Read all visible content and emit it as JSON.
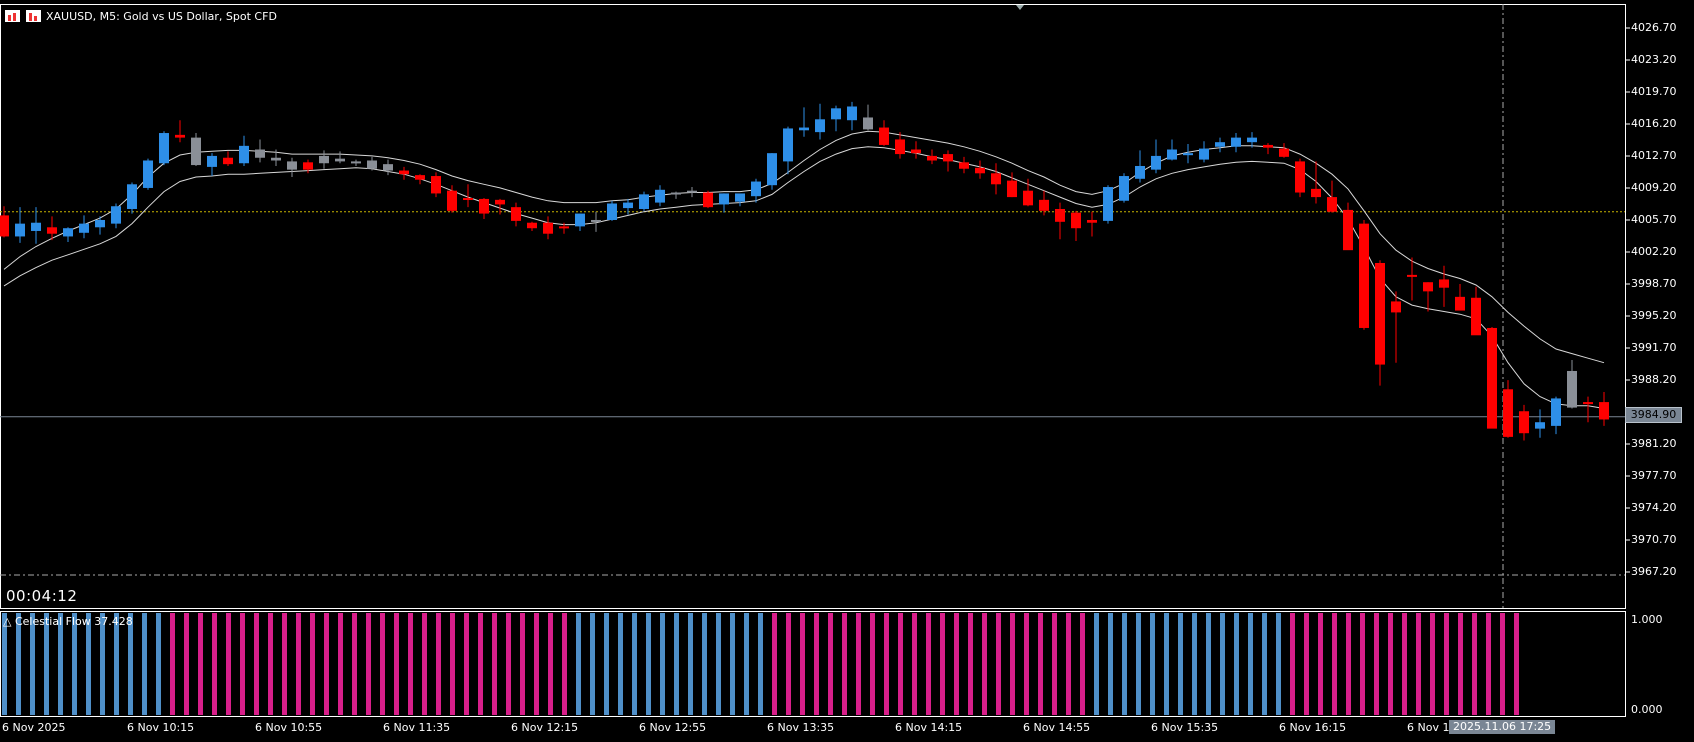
{
  "window": {
    "title": "XAUUSD, M5:  Gold vs US Dollar, Spot CFD",
    "countdown": "00:04:12"
  },
  "price_axis": {
    "labels": [
      "4026.70",
      "4023.20",
      "4019.70",
      "4016.20",
      "4012.70",
      "4009.20",
      "4005.70",
      "4002.20",
      "3998.70",
      "3995.20",
      "3991.70",
      "3988.20",
      "3984.90",
      "3981.20",
      "3977.70",
      "3974.20",
      "3970.70",
      "3967.20"
    ],
    "current_price": "3984.90"
  },
  "time_axis": {
    "labels": [
      "6 Nov 2025",
      "6 Nov 10:15",
      "6 Nov 10:55",
      "6 Nov 11:35",
      "6 Nov 12:15",
      "6 Nov 12:55",
      "6 Nov 13:35",
      "6 Nov 14:15",
      "6 Nov 14:55",
      "6 Nov 15:35",
      "6 Nov 16:15",
      "6 Nov 1"
    ],
    "crosshair_time": "2025.11.06 17:25"
  },
  "indicator": {
    "name": "Celestial Flow 37.428",
    "axis_labels": [
      "1.000",
      "0.000"
    ],
    "pattern": "BBBBBBBBBBBBPPPPPPPPPPPPPPPPPPPPPPPPPPPPPBBBBBBBBBBBBBBPPPPPPPPPPPPPPPPPPPPPPPBBBBBBBBBBBBBBPPPPPPPPPPPPPPPPPPPPP"
  },
  "colors": {
    "bull": "#2e8fe8",
    "bear": "#ff0000",
    "neutral": "#8a8f97",
    "ma": "#d8d8d8",
    "level_line": "#c8b400",
    "hist_blue": "#4f8fc8",
    "hist_pink": "#d81f8b"
  },
  "chart_data": {
    "type": "candlestick",
    "symbol": "XAUUSD",
    "timeframe": "M5",
    "candles": [
      [
        4006.9,
        4007.9,
        4004.5,
        4004.6,
        "bear"
      ],
      [
        4004.6,
        4007.8,
        4003.9,
        4006.0,
        "bull"
      ],
      [
        4005.2,
        4007.8,
        4003.8,
        4006.1,
        "bull"
      ],
      [
        4005.6,
        4006.8,
        4004.2,
        4004.9,
        "bear"
      ],
      [
        4004.6,
        4005.6,
        4004.0,
        4005.5,
        "bull"
      ],
      [
        4005.0,
        4006.9,
        4004.4,
        4006.0,
        "bull"
      ],
      [
        4005.6,
        4006.8,
        4004.8,
        4006.4,
        "bull"
      ],
      [
        4006.0,
        4008.2,
        4005.5,
        4007.9,
        "bull"
      ],
      [
        4007.6,
        4010.5,
        4007.1,
        4010.3,
        "bull"
      ],
      [
        4009.9,
        4013.1,
        4009.7,
        4012.9,
        "bull"
      ],
      [
        4012.6,
        4016.1,
        4012.4,
        4015.9,
        "bull"
      ],
      [
        4015.7,
        4017.3,
        4014.9,
        4015.4,
        "bear"
      ],
      [
        4015.4,
        4015.9,
        4012.3,
        4012.4,
        "neutral"
      ],
      [
        4012.2,
        4013.7,
        4011.2,
        4013.4,
        "bull"
      ],
      [
        4013.2,
        4013.9,
        4012.3,
        4012.5,
        "bear"
      ],
      [
        4012.6,
        4015.6,
        4012.3,
        4014.5,
        "bull"
      ],
      [
        4014.1,
        4015.2,
        4012.7,
        4013.2,
        "neutral"
      ],
      [
        4013.2,
        4014.1,
        4012.3,
        4012.9,
        "neutral"
      ],
      [
        4012.8,
        4013.2,
        4011.1,
        4011.9,
        "neutral"
      ],
      [
        4011.9,
        4013.0,
        4011.5,
        4012.7,
        "bear"
      ],
      [
        4012.6,
        4014.0,
        4012.0,
        4013.4,
        "neutral"
      ],
      [
        4013.1,
        4013.9,
        4012.6,
        4012.8,
        "neutral"
      ],
      [
        4012.8,
        4013.0,
        4012.3,
        4012.6,
        "neutral"
      ],
      [
        4012.9,
        4013.3,
        4011.8,
        4012.0,
        "neutral"
      ],
      [
        4012.5,
        4013.0,
        4011.3,
        4011.8,
        "neutral"
      ],
      [
        4011.8,
        4012.2,
        4010.8,
        4011.4,
        "bear"
      ],
      [
        4011.3,
        4011.4,
        4010.3,
        4010.8,
        "bear"
      ],
      [
        4011.2,
        4011.6,
        4008.9,
        4009.3,
        "bear"
      ],
      [
        4009.6,
        4010.2,
        4007.2,
        4007.4,
        "bear"
      ],
      [
        4008.8,
        4010.3,
        4007.8,
        4008.6,
        "bear"
      ],
      [
        4008.7,
        4008.8,
        4006.5,
        4007.1,
        "bear"
      ],
      [
        4008.6,
        4008.7,
        4007.0,
        4008.1,
        "bear"
      ],
      [
        4007.8,
        4008.3,
        4005.7,
        4006.3,
        "bear"
      ],
      [
        4006.1,
        4006.2,
        4005.2,
        4005.5,
        "bear"
      ],
      [
        4006.1,
        4006.8,
        4004.3,
        4004.9,
        "bear"
      ],
      [
        4005.5,
        4006.1,
        4004.9,
        4005.7,
        "bear"
      ],
      [
        4005.7,
        4007.1,
        4005.2,
        4007.1,
        "bull"
      ],
      [
        4006.4,
        4007.3,
        4005.1,
        4006.2,
        "neutral"
      ],
      [
        4006.4,
        4008.5,
        4006.3,
        4008.2,
        "bull"
      ],
      [
        4007.7,
        4008.7,
        4007.0,
        4008.3,
        "bull"
      ],
      [
        4007.6,
        4009.5,
        4007.4,
        4009.2,
        "bull"
      ],
      [
        4008.3,
        4010.2,
        4007.9,
        4009.7,
        "bull"
      ],
      [
        4009.4,
        4009.5,
        4008.7,
        4009.2,
        "neutral"
      ],
      [
        4009.5,
        4010.0,
        4008.9,
        4009.6,
        "neutral"
      ],
      [
        4009.4,
        4009.6,
        4007.7,
        4007.8,
        "bear"
      ],
      [
        4008.1,
        4009.3,
        4007.2,
        4009.3,
        "bull"
      ],
      [
        4008.4,
        4009.2,
        4007.9,
        4009.3,
        "bull"
      ],
      [
        4009.0,
        4010.9,
        4008.3,
        4010.6,
        "bull"
      ],
      [
        4010.2,
        4013.7,
        4009.7,
        4013.7,
        "bull"
      ],
      [
        4012.8,
        4016.6,
        4011.4,
        4016.4,
        "bull"
      ],
      [
        4016.2,
        4018.7,
        4015.5,
        4016.5,
        "bull"
      ],
      [
        4016.0,
        4019.1,
        4015.2,
        4017.4,
        "bull"
      ],
      [
        4017.4,
        4018.9,
        4016.1,
        4018.6,
        "bull"
      ],
      [
        4018.8,
        4019.3,
        4016.2,
        4017.3,
        "bull"
      ],
      [
        4017.6,
        4019.0,
        4016.2,
        4016.3,
        "neutral"
      ],
      [
        4016.5,
        4017.3,
        4014.5,
        4014.6,
        "bear"
      ],
      [
        4015.2,
        4016.0,
        4013.1,
        4013.6,
        "bear"
      ],
      [
        4013.7,
        4015.0,
        4013.1,
        4014.1,
        "bear"
      ],
      [
        4013.4,
        4014.1,
        4012.5,
        4012.9,
        "bear"
      ],
      [
        4013.6,
        4014.0,
        4011.7,
        4012.8,
        "bear"
      ],
      [
        4012.7,
        4013.3,
        4011.5,
        4012.0,
        "bear"
      ],
      [
        4012.1,
        4012.9,
        4010.9,
        4011.5,
        "bear"
      ],
      [
        4011.5,
        4012.6,
        4009.2,
        4010.3,
        "bear"
      ],
      [
        4010.7,
        4011.6,
        4008.9,
        4008.9,
        "bear"
      ],
      [
        4009.6,
        4010.9,
        4007.9,
        4008.0,
        "bear"
      ],
      [
        4008.6,
        4009.6,
        4006.9,
        4007.4,
        "bear"
      ],
      [
        4007.6,
        4008.3,
        4004.3,
        4006.2,
        "bear"
      ],
      [
        4007.2,
        4007.4,
        4004.1,
        4005.5,
        "bear"
      ],
      [
        4006.1,
        4007.3,
        4004.6,
        4006.4,
        "bear"
      ],
      [
        4006.3,
        4010.2,
        4006.0,
        4010.0,
        "bull"
      ],
      [
        4008.5,
        4011.5,
        4008.3,
        4011.2,
        "bull"
      ],
      [
        4010.9,
        4014.0,
        4010.5,
        4012.3,
        "bull"
      ],
      [
        4011.9,
        4015.2,
        4011.5,
        4013.4,
        "bull"
      ],
      [
        4013.0,
        4015.2,
        4012.9,
        4014.1,
        "bull"
      ],
      [
        4013.7,
        4014.7,
        4012.6,
        4013.7,
        "bull"
      ],
      [
        4013.0,
        4015.0,
        4012.7,
        4014.2,
        "bull"
      ],
      [
        4014.4,
        4015.4,
        4013.8,
        4014.9,
        "bull"
      ],
      [
        4014.4,
        4015.9,
        4013.8,
        4015.4,
        "bull"
      ],
      [
        4015.4,
        4016.0,
        4014.3,
        4014.9,
        "bull"
      ],
      [
        4014.6,
        4014.8,
        4013.6,
        4014.3,
        "bear"
      ],
      [
        4014.2,
        4014.8,
        4013.2,
        4013.3,
        "bear"
      ],
      [
        4012.8,
        4013.1,
        4008.9,
        4009.4,
        "bear"
      ],
      [
        4009.8,
        4012.8,
        4008.2,
        4008.9,
        "bear"
      ],
      [
        4008.9,
        4010.7,
        4007.2,
        4007.3,
        "bear"
      ],
      [
        4007.5,
        4008.3,
        4003.2,
        4003.1,
        "bear"
      ],
      [
        4006.0,
        4006.4,
        3994.4,
        3994.6,
        "bear"
      ],
      [
        4001.7,
        4002.0,
        3988.3,
        3990.6,
        "bear"
      ],
      [
        3997.5,
        3998.6,
        3990.8,
        3996.3,
        "bear"
      ],
      [
        4000.3,
        4002.3,
        3997.6,
        4000.4,
        "bear"
      ],
      [
        3999.6,
        3999.6,
        3996.4,
        3998.6,
        "bear"
      ],
      [
        3999.9,
        4001.4,
        3996.9,
        3999.0,
        "bear"
      ],
      [
        3998.0,
        3999.4,
        3996.6,
        3996.5,
        "bear"
      ],
      [
        3997.9,
        3999.1,
        3996.0,
        3993.8,
        "bear"
      ],
      [
        3994.6,
        3994.7,
        3986.9,
        3983.6,
        "bear"
      ],
      [
        3987.9,
        3988.9,
        3982.6,
        3982.7,
        "bear"
      ],
      [
        3985.5,
        3986.2,
        3982.3,
        3983.1,
        "bear"
      ],
      [
        3983.6,
        3985.7,
        3982.6,
        3984.3,
        "bull"
      ],
      [
        3983.9,
        3987.1,
        3983.0,
        3986.9,
        "bull"
      ],
      [
        3989.9,
        3991.1,
        3985.8,
        3985.9,
        "neutral"
      ],
      [
        3986.4,
        3987.1,
        3984.3,
        3986.5,
        "bear"
      ],
      [
        3986.5,
        3987.6,
        3983.9,
        3984.6,
        "bear"
      ]
    ],
    "moving_averages": [
      {
        "name": "upper",
        "values": [
          4001.0,
          4002.4,
          4003.5,
          4004.4,
          4005.2,
          4005.9,
          4006.6,
          4007.6,
          4009.2,
          4011.1,
          4012.6,
          4013.5,
          4013.8,
          4013.9,
          4014.0,
          4014.0,
          4013.9,
          4013.8,
          4013.6,
          4013.6,
          4013.6,
          4013.6,
          4013.5,
          4013.4,
          4013.2,
          4012.9,
          4012.5,
          4011.9,
          4011.2,
          4010.7,
          4010.3,
          4009.9,
          4009.4,
          4008.9,
          4008.5,
          4008.3,
          4008.3,
          4008.3,
          4008.5,
          4008.6,
          4008.9,
          4009.1,
          4009.3,
          4009.4,
          4009.4,
          4009.5,
          4009.5,
          4009.7,
          4010.4,
          4011.6,
          4012.9,
          4014.1,
          4015.1,
          4015.8,
          4016.1,
          4016.0,
          4015.7,
          4015.4,
          4015.1,
          4014.8,
          4014.4,
          4013.9,
          4013.3,
          4012.6,
          4011.8,
          4011.1,
          4010.2,
          4009.5,
          4009.2,
          4009.6,
          4010.4,
          4011.6,
          4012.6,
          4013.4,
          4013.8,
          4014.1,
          4014.3,
          4014.5,
          4014.5,
          4014.4,
          4014.3,
          4013.6,
          4012.6,
          4011.4,
          4009.8,
          4007.4,
          4004.9,
          4003.1,
          4001.9,
          4001.1,
          4000.5,
          4000.0,
          3999.3,
          3998.0,
          3996.3,
          3994.8,
          3993.4,
          3992.3,
          3991.8,
          3991.3,
          3990.8
        ]
      },
      {
        "name": "lower",
        "values": [
          3999.2,
          4000.3,
          4001.2,
          4002.0,
          4002.6,
          4003.2,
          4003.8,
          4004.6,
          4006.0,
          4007.8,
          4009.5,
          4010.6,
          4011.1,
          4011.2,
          4011.4,
          4011.4,
          4011.5,
          4011.6,
          4011.7,
          4011.8,
          4011.9,
          4012.0,
          4012.1,
          4012.0,
          4011.7,
          4011.4,
          4010.9,
          4010.3,
          4009.6,
          4008.9,
          4008.3,
          4007.7,
          4007.1,
          4006.6,
          4006.1,
          4005.9,
          4005.9,
          4006.1,
          4006.5,
          4006.9,
          4007.3,
          4007.6,
          4007.8,
          4008.0,
          4008.1,
          4008.2,
          4008.3,
          4008.5,
          4009.2,
          4010.5,
          4011.7,
          4012.8,
          4013.6,
          4014.2,
          4014.4,
          4014.3,
          4014.0,
          4013.7,
          4013.3,
          4013.0,
          4012.6,
          4012.2,
          4011.7,
          4011.0,
          4010.3,
          4009.6,
          4008.9,
          4008.2,
          4007.8,
          4008.1,
          4008.9,
          4010.0,
          4010.9,
          4011.5,
          4011.9,
          4012.2,
          4012.5,
          4012.7,
          4012.8,
          4012.7,
          4012.6,
          4011.9,
          4010.6,
          4008.8,
          4006.5,
          4003.4,
          4000.0,
          3998.0,
          3997.1,
          3996.7,
          3996.4,
          3996.1,
          3995.6,
          3993.7,
          3990.8,
          3988.5,
          3987.1,
          3986.3,
          3986.1,
          3986.1,
          3985.8
        ]
      }
    ],
    "levels": [
      {
        "name": "dotted-level",
        "price": 4007.3,
        "style": "dotted"
      },
      {
        "name": "bid-line",
        "price": 3984.9,
        "style": "solid"
      },
      {
        "name": "dash-dot-level",
        "price": 3967.6,
        "style": "dashdot"
      }
    ],
    "ylim": [
      3964.0,
      4030.0
    ],
    "crosshair": {
      "time": "2025.11.06 17:25",
      "style": "dashdot"
    }
  }
}
